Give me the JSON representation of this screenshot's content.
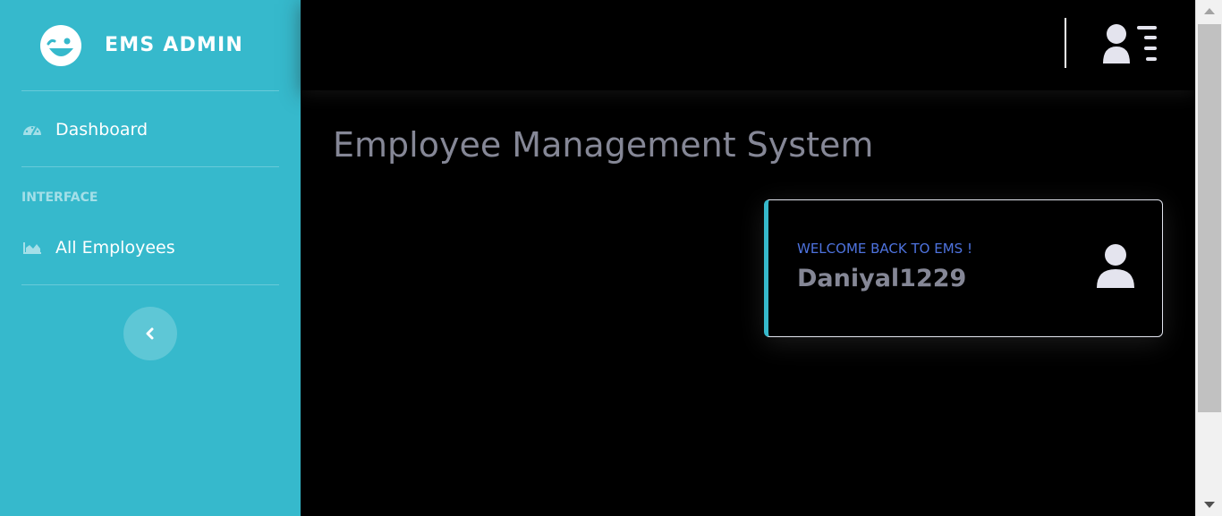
{
  "app": {
    "brand_name": "EMS ADMIN",
    "brand_icon": "laugh-wink-icon",
    "accent_color": "#36b9cc"
  },
  "sidebar": {
    "items_top": [
      {
        "label": "Dashboard",
        "icon": "tachometer-icon"
      }
    ],
    "section_heading": "INTERFACE",
    "items_interface": [
      {
        "label": "All Employees",
        "icon": "area-chart-icon"
      }
    ],
    "toggle_icon": "chevron-left-icon"
  },
  "topbar": {
    "user_menu_icon": "user-list-icon"
  },
  "main": {
    "page_title": "Employee Management System",
    "welcome_card": {
      "eyebrow": "WELCOME BACK TO EMS !",
      "username": "Daniyal1229",
      "icon": "user-icon",
      "eyebrow_color": "#4e73df",
      "text_color": "#858796"
    }
  }
}
